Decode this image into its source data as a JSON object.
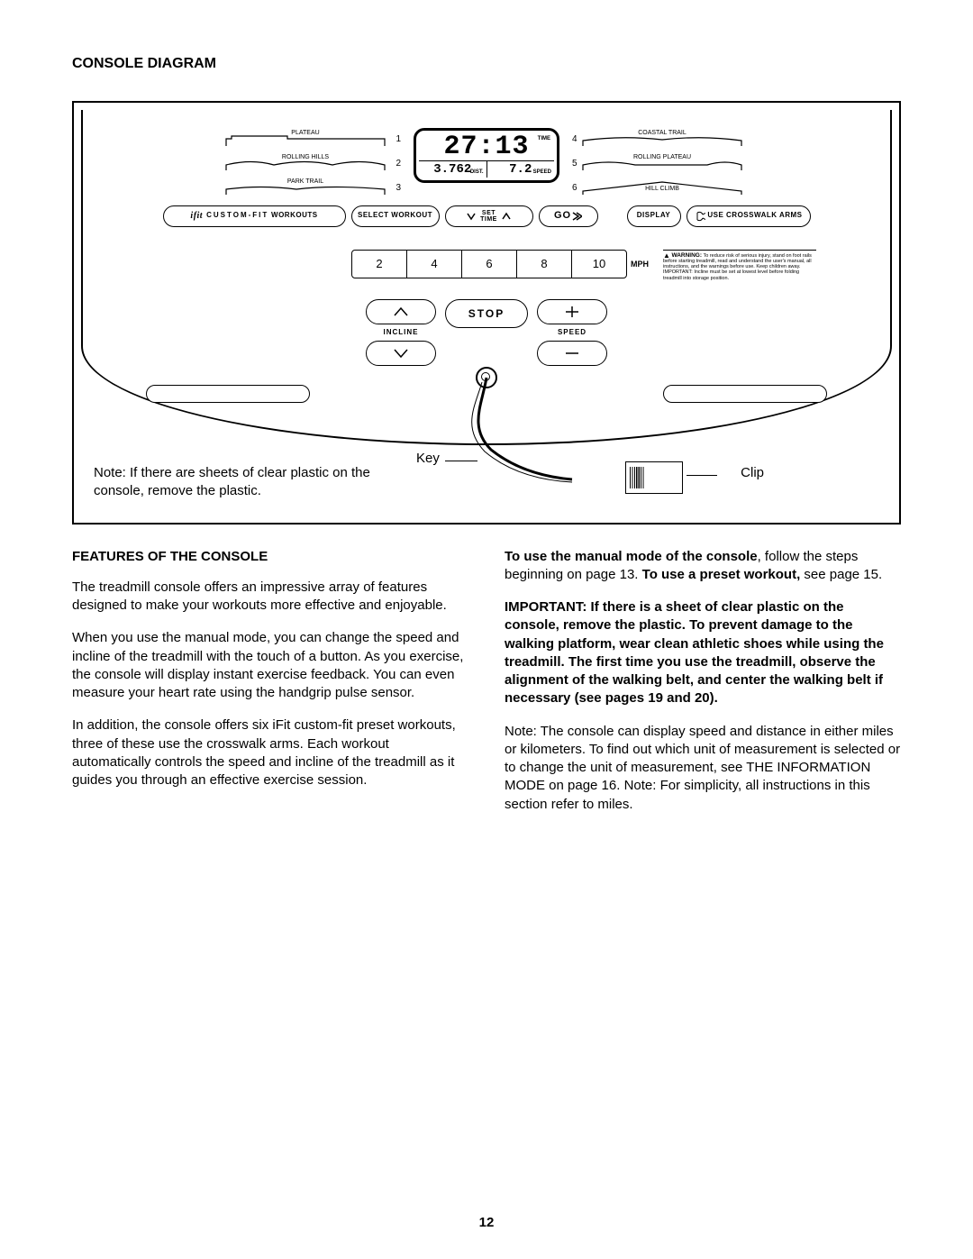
{
  "title": "CONSOLE DIAGRAM",
  "diagram": {
    "workouts_left": [
      {
        "label": "PLATEAU",
        "num": "1"
      },
      {
        "label": "ROLLING HILLS",
        "num": "2"
      },
      {
        "label": "PARK TRAIL",
        "num": "3"
      }
    ],
    "workouts_right": [
      {
        "label": "COASTAL TRAIL",
        "num": "4"
      },
      {
        "label": "ROLLING PLATEAU",
        "num": "5"
      },
      {
        "label": "HILL CLIMB",
        "num": "6"
      }
    ],
    "lcd": {
      "time_value": "27:13",
      "time_label": "TIME",
      "dist_value": "3.762",
      "dist_label": "DIST.",
      "speed_value": "7.2",
      "speed_label": "SPEED"
    },
    "row_buttons": {
      "ifit_pre": "ifit",
      "ifit": "CUSTOM-FIT",
      "ifit_suffix": "WORKOUTS",
      "select": "SELECT WORKOUT",
      "set_time": "SET\nTIME",
      "go": "GO",
      "display": "DISPLAY",
      "cross": "USE CROSSWALK ARMS"
    },
    "speeds": [
      "2",
      "4",
      "6",
      "8",
      "10"
    ],
    "mph": "MPH",
    "warning_prefix": "WARNING:",
    "warning_body": "To reduce risk of serious injury, stand on foot rails before starting treadmill, read and understand the user's manual, all instructions, and the warnings before use. Keep children away. IMPORTANT: Incline must be set at lowest level before folding treadmill into storage position.",
    "incline": "INCLINE",
    "stop": "STOP",
    "speed": "SPEED",
    "note": "Note: If there are sheets of clear plastic on the console, remove the plastic.",
    "key_label": "Key",
    "clip_label": "Clip"
  },
  "features": {
    "heading": "FEATURES OF THE CONSOLE",
    "p1": "The treadmill console offers an impressive array of features designed to make your workouts more effective and enjoyable.",
    "p2": "When you use the manual mode, you can change the speed and incline of the treadmill with the touch of a button. As you exercise, the console will display instant exercise feedback. You can even measure your heart rate using the handgrip pulse sensor.",
    "p3": "In addition, the console offers six iFit custom-fit preset workouts, three of these use the crosswalk arms. Each workout automatically controls the speed and incline of the treadmill as it guides you through an effective exercise session.",
    "r1a": "To use the manual mode of the console",
    "r1b": ", follow the steps beginning on page 13. ",
    "r1c": "To use a preset workout,",
    "r1d": " see page 15.",
    "r2": "IMPORTANT: If there is a sheet of clear plastic on the console, remove the plastic. To prevent damage to the walking platform, wear clean athletic shoes while using the treadmill. The first time you use the treadmill, observe the alignment of the walking belt, and center the walking belt if necessary (see pages 19 and 20).",
    "r3": "Note: The console can display speed and distance in either miles or kilometers. To find out which unit of measurement is selected or to change the unit of measurement, see THE INFORMATION MODE on page 16. Note: For simplicity, all instructions in this section refer to miles."
  },
  "page_number": "12"
}
